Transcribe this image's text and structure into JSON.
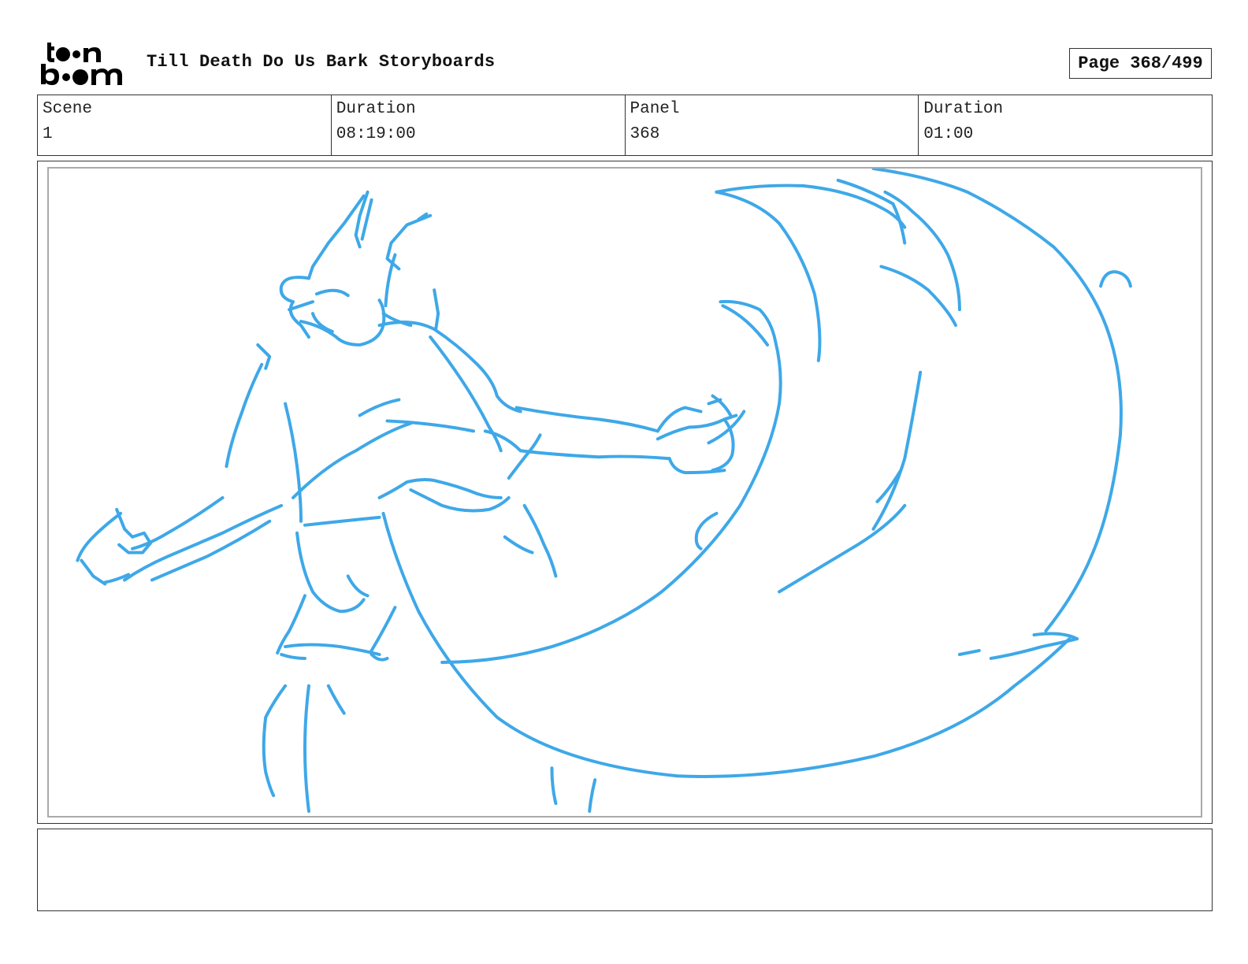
{
  "header": {
    "logo_top": "to•n",
    "logo_bottom": "b•om",
    "title": "Till Death Do Us Bark Storyboards",
    "page_label": "Page 368/499"
  },
  "info": {
    "scene_label": "Scene",
    "scene_value": "1",
    "scene_duration_label": "Duration",
    "scene_duration_value": "08:19:00",
    "panel_label": "Panel",
    "panel_value": "368",
    "panel_duration_label": "Duration",
    "panel_duration_value": "01:00"
  },
  "sketch": {
    "stroke_color": "#3ea8e8"
  },
  "notes": {
    "text": ""
  }
}
